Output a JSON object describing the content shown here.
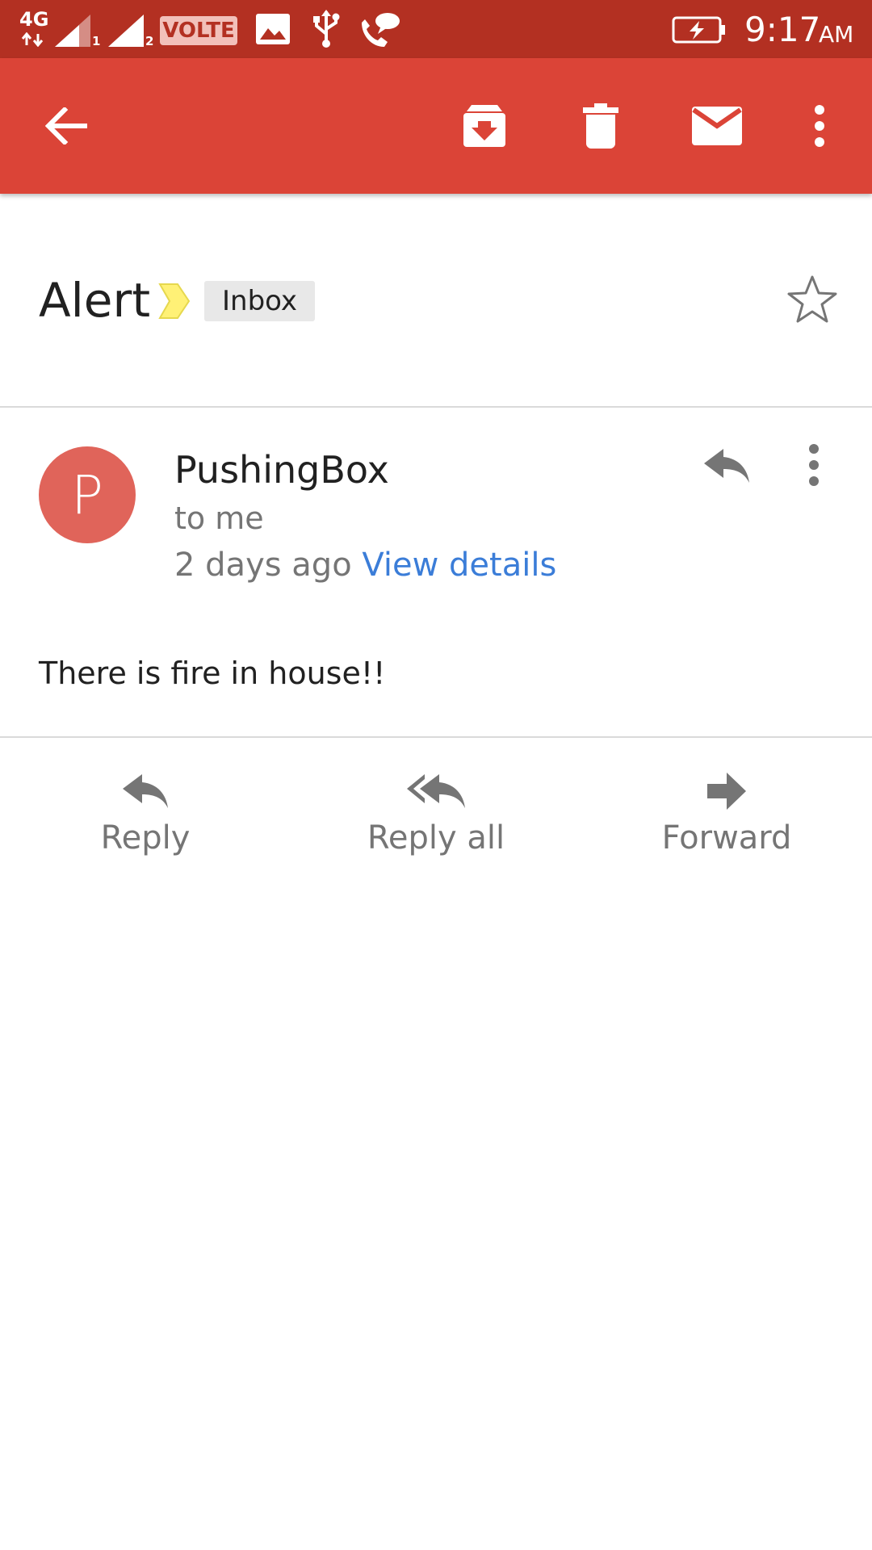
{
  "status_bar": {
    "network_label": "4G",
    "sim1_index": "1",
    "sim2_index": "2",
    "volte_label": "VOLTE",
    "time": "9:17",
    "ampm": "AM"
  },
  "app_bar": {
    "icons": [
      "back-arrow-icon",
      "archive-icon",
      "delete-icon",
      "mark-unread-icon",
      "more-vert-icon"
    ],
    "color": "#DB4437",
    "status_color": "#B33022"
  },
  "email": {
    "subject": "Alert",
    "label": "Inbox",
    "starred": false,
    "sender_initial": "P",
    "sender_name": "PushingBox",
    "recipient": "to me",
    "date": "2 days ago",
    "view_details": "View details",
    "body": "There is fire in house!!"
  },
  "actions": {
    "reply": "Reply",
    "reply_all": "Reply all",
    "forward": "Forward"
  },
  "colors": {
    "link": "#3B7DD8",
    "avatar": "#E0645A",
    "importance_marker": "#FFF176",
    "icon_gray": "#757575"
  }
}
